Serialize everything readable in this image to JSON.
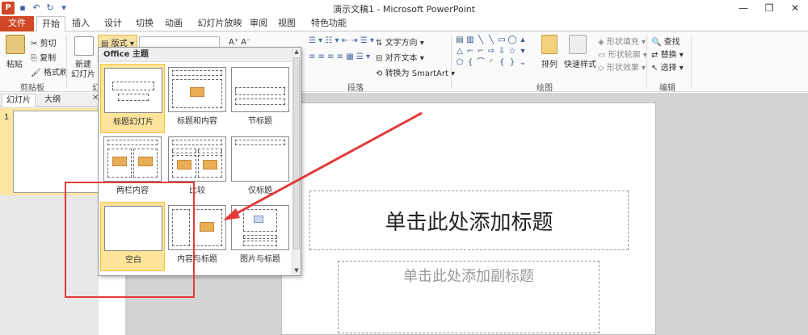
{
  "window": {
    "title": "演示文稿1 - Microsoft PowerPoint"
  },
  "tabs": [
    "文件",
    "开始",
    "插入",
    "设计",
    "切换",
    "动画",
    "幻灯片放映",
    "审阅",
    "视图",
    "特色功能"
  ],
  "ribbon": {
    "clipboard": {
      "paste": "粘贴",
      "cut": "剪切",
      "copy": "复制",
      "format_painter": "格式刷",
      "label": "剪贴板"
    },
    "slides": {
      "new_slide_1": "新建",
      "new_slide_2": "幻灯片",
      "layout": "版式",
      "label_partial": "幻"
    },
    "paragraph": {
      "text_direction": "文字方向",
      "align_text": "对齐文本",
      "convert_smartart": "转换为 SmartArt",
      "label": "段落"
    },
    "drawing": {
      "arrange": "排列",
      "quick_styles": "快速样式",
      "shape_fill": "形状填充",
      "shape_outline": "形状轮廓",
      "shape_effects": "形状效果",
      "label": "绘图"
    },
    "editing": {
      "find": "查找",
      "replace": "替换",
      "select": "选择",
      "label": "编辑"
    }
  },
  "pane": {
    "tab_slides": "幻灯片",
    "tab_outline": "大纲",
    "slide_number": "1"
  },
  "layout_gallery": {
    "header": "Office 主题",
    "items": [
      "标题幻灯片",
      "标题和内容",
      "节标题",
      "两栏内容",
      "比较",
      "仅标题",
      "空白",
      "内容与标题",
      "图片与标题"
    ],
    "selected": "空白"
  },
  "slide": {
    "title_placeholder": "单击此处添加标题",
    "subtitle_placeholder": "单击此处添加副标题"
  },
  "colors": {
    "file_tab": "#d24726",
    "annotation_red": "#e23a3a",
    "selection_fill": "#fde49a"
  }
}
